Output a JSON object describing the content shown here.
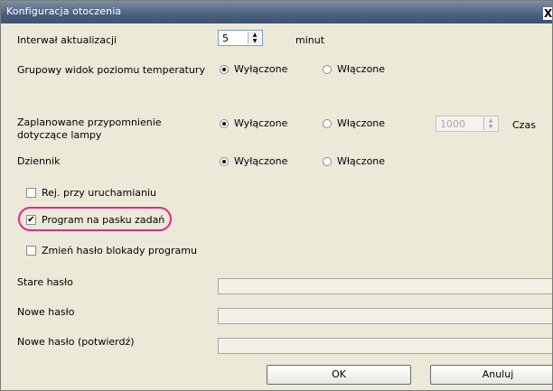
{
  "window": {
    "title": "Konfiguracja otoczenia",
    "close_glyph": "X"
  },
  "update_interval": {
    "label": "Interwał aktualizacji",
    "value": "5",
    "unit": "minut"
  },
  "group_temp_view": {
    "label": "Grupowy widok poziomu temperatury",
    "option_off": "Wyłączone",
    "option_on": "Włączone",
    "selected": "off"
  },
  "lamp_reminder": {
    "label": "Zaplanowane przypomnienie dotyczące lampy",
    "option_off": "Wyłączone",
    "option_on": "Włączone",
    "selected": "off",
    "time_value": "1000",
    "time_label": "Czas"
  },
  "log": {
    "label": "Dziennik",
    "option_off": "Wyłączone",
    "option_on": "Włączone",
    "selected": "off"
  },
  "checkboxes": {
    "startup_log": {
      "label": "Rej. przy uruchamianiu",
      "checked": false
    },
    "taskbar": {
      "label": "Program na pasku zadań",
      "checked": true
    },
    "change_lock_password": {
      "label": "Zmień hasło blokady programu",
      "checked": false
    }
  },
  "passwords": {
    "old_label": "Stare hasło",
    "new_label": "Nowe hasło",
    "confirm_label": "Nowe hasło (potwierdź)"
  },
  "buttons": {
    "ok": "OK",
    "cancel": "Anuluj"
  },
  "icons": {
    "spin_up": "▲",
    "spin_down": "▼",
    "check_mark": "✔"
  },
  "colors": {
    "highlight": "#e0288b",
    "dialog_bg": "#ece9d8"
  }
}
